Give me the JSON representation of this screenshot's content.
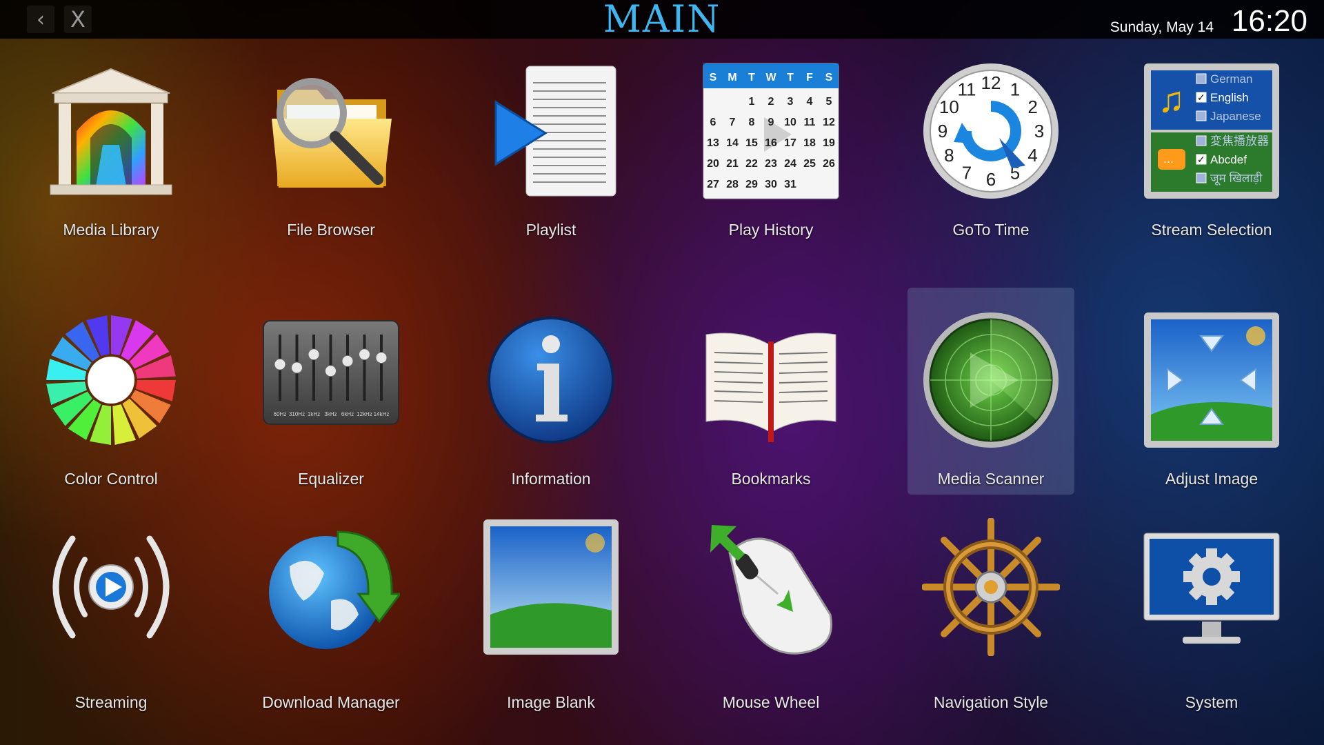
{
  "header": {
    "title": "MAIN",
    "back_icon": "‹",
    "close_icon": "X",
    "date": "Sunday, May 14",
    "time": "16:20"
  },
  "tiles": [
    {
      "label": "Media Library",
      "icon": "temple-icon"
    },
    {
      "label": "File Browser",
      "icon": "folder-magnifier-icon"
    },
    {
      "label": "Playlist",
      "icon": "playlist-icon"
    },
    {
      "label": "Play History",
      "icon": "calendar-icon"
    },
    {
      "label": "GoTo Time",
      "icon": "clock-icon"
    },
    {
      "label": "Stream Selection",
      "icon": "stream-selection-icon"
    },
    {
      "label": "Color Control",
      "icon": "color-wheel-icon"
    },
    {
      "label": "Equalizer",
      "icon": "equalizer-icon"
    },
    {
      "label": "Information",
      "icon": "info-icon"
    },
    {
      "label": "Bookmarks",
      "icon": "book-icon"
    },
    {
      "label": "Media Scanner",
      "icon": "radar-icon",
      "selected": true
    },
    {
      "label": "Adjust Image",
      "icon": "adjust-image-icon"
    },
    {
      "label": "Streaming",
      "icon": "streaming-icon"
    },
    {
      "label": "Download Manager",
      "icon": "globe-download-icon"
    },
    {
      "label": "Image Blank",
      "icon": "image-blank-icon"
    },
    {
      "label": "Mouse Wheel",
      "icon": "mouse-icon"
    },
    {
      "label": "Navigation Style",
      "icon": "ship-wheel-icon"
    },
    {
      "label": "System",
      "icon": "monitor-gear-icon"
    }
  ],
  "calendar": {
    "weekdays": [
      "S",
      "M",
      "T",
      "W",
      "T",
      "F",
      "S"
    ],
    "rows": [
      [
        "",
        "",
        "1",
        "2",
        "3",
        "4",
        "5"
      ],
      [
        "6",
        "7",
        "8",
        "9",
        "10",
        "11",
        "12"
      ],
      [
        "13",
        "14",
        "15",
        "16",
        "17",
        "18",
        "19"
      ],
      [
        "20",
        "21",
        "22",
        "23",
        "24",
        "25",
        "26"
      ],
      [
        "27",
        "28",
        "29",
        "30",
        "31",
        "",
        ""
      ]
    ]
  },
  "clock_numbers": [
    "12",
    "1",
    "2",
    "3",
    "4",
    "5",
    "6",
    "7",
    "8",
    "9",
    "10",
    "11"
  ],
  "stream_selection": {
    "audio": [
      {
        "label": "German",
        "checked": false
      },
      {
        "label": "English",
        "checked": true
      },
      {
        "label": "Japanese",
        "checked": false
      }
    ],
    "subtitles": [
      {
        "label": "変焦播放器",
        "checked": false
      },
      {
        "label": "Abcdef",
        "checked": true
      },
      {
        "label": "जूम खिलाड़ी",
        "checked": false
      }
    ]
  },
  "equalizer": {
    "bands": [
      "60Hz",
      "310Hz",
      "1kHz",
      "3kHz",
      "6kHz",
      "12kHz",
      "14kHz"
    ],
    "levels": [
      0.45,
      0.5,
      0.3,
      0.55,
      0.4,
      0.3,
      0.35
    ]
  },
  "colors": {
    "title": "#3fb6ef",
    "selected_tile": "#6e82aa"
  }
}
